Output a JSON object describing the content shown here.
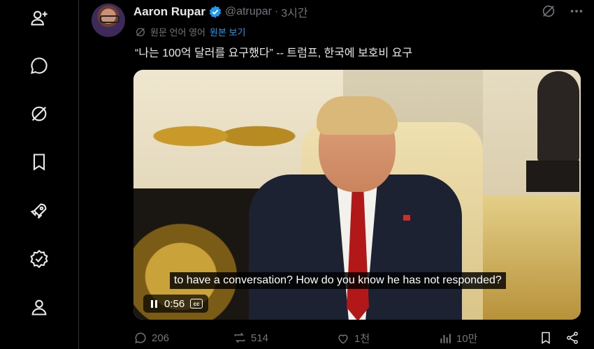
{
  "nav": {
    "items": [
      {
        "icon": "add-person-icon"
      },
      {
        "icon": "message-icon"
      },
      {
        "icon": "grok-icon"
      },
      {
        "icon": "bookmark-icon"
      },
      {
        "icon": "rocket-icon"
      },
      {
        "icon": "verified-icon"
      },
      {
        "icon": "profile-icon"
      }
    ]
  },
  "tweet": {
    "author_name": "Aaron Rupar",
    "handle": "@atrupar",
    "separator": "·",
    "time": "3시간",
    "translate_note": "원문 언어 영어",
    "translate_link": "원본 보기",
    "text": "“나는 100억 달러를 요구했다” -- 트럼프, 한국에 보호비 요구",
    "video": {
      "caption": "to have a conversation? How do you know he has not responded?",
      "time": "0:56",
      "cc_label": "cc"
    },
    "actions": {
      "replies": "206",
      "reposts": "514",
      "likes": "1천",
      "views": "10만"
    }
  },
  "colors": {
    "accent": "#1d9bf0",
    "muted": "#71767b",
    "text": "#e7e9ea"
  }
}
